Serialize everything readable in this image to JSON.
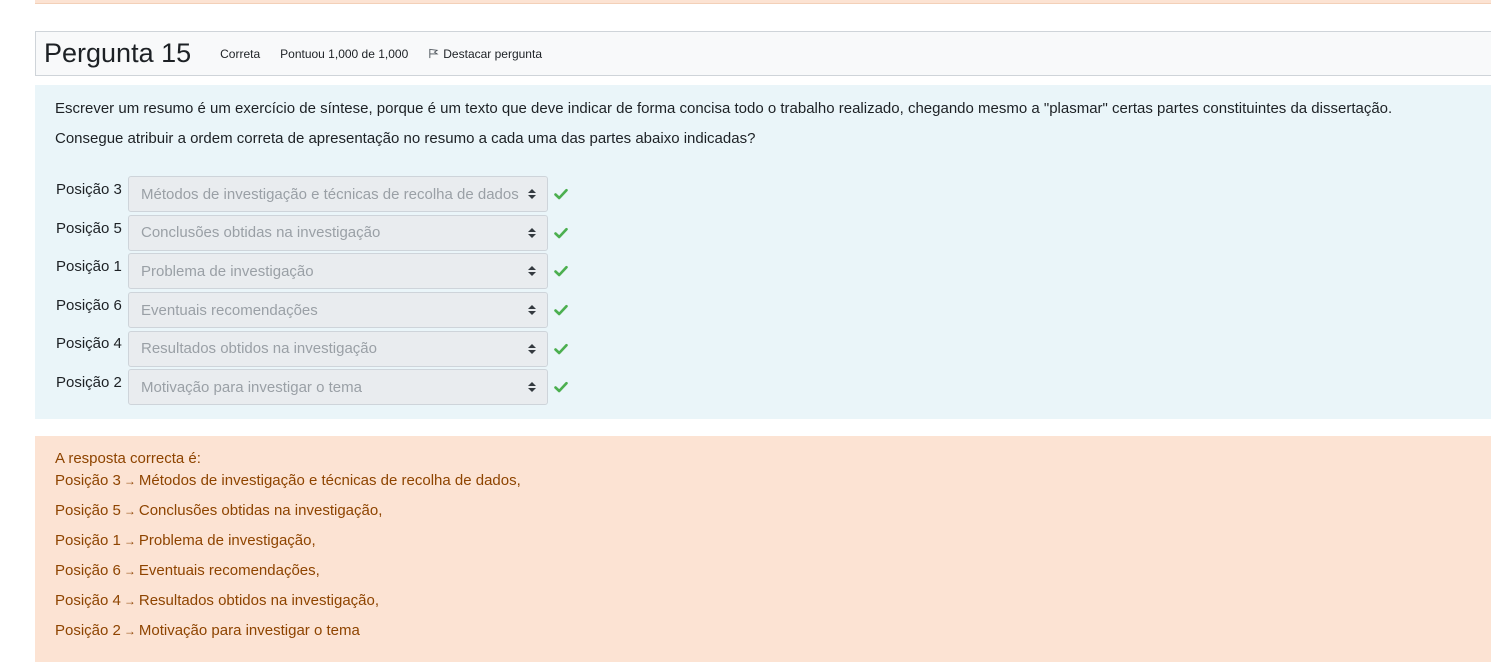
{
  "question": {
    "title": "Pergunta 15",
    "state": "Correta",
    "grade": "Pontuou 1,000 de 1,000",
    "flag_label": "Destacar pergunta",
    "text_1": "Escrever um resumo é um exercício de síntese, porque é um texto que deve indicar de forma concisa todo o trabalho realizado, chegando mesmo a \"plasmar\" certas partes constituintes da dissertação.",
    "text_2": "Consegue atribuir a ordem correta de apresentação no resumo a cada uma das partes abaixo indicadas?",
    "rows": [
      {
        "label": "Posição 3",
        "selected": "Métodos de investigação e técnicas de recolha de dados",
        "status": "correct"
      },
      {
        "label": "Posição 5",
        "selected": "Conclusões obtidas na investigação",
        "status": "correct"
      },
      {
        "label": "Posição 1",
        "selected": "Problema de investigação",
        "status": "correct"
      },
      {
        "label": "Posição 6",
        "selected": "Eventuais recomendações",
        "status": "correct"
      },
      {
        "label": "Posição 4",
        "selected": "Resultados obtidos na investigação",
        "status": "correct"
      },
      {
        "label": "Posição 2",
        "selected": "Motivação para investigar o tema",
        "status": "correct"
      }
    ]
  },
  "feedback": {
    "heading": "A resposta correcta é:",
    "arrow": "→",
    "lines": [
      {
        "pos": "Posição 3",
        "answer": "Métodos de investigação e técnicas de recolha de dados,"
      },
      {
        "pos": "Posição 5",
        "answer": "Conclusões obtidas na investigação,"
      },
      {
        "pos": "Posição 1",
        "answer": "Problema de investigação,"
      },
      {
        "pos": "Posição 6",
        "answer": "Eventuais recomendações,"
      },
      {
        "pos": "Posição 4",
        "answer": "Resultados obtidos na investigação,"
      },
      {
        "pos": "Posição 2",
        "answer": "Motivação para investigar o tema"
      }
    ]
  },
  "colors": {
    "correct_check": "#4caf50",
    "feedback_bg": "#fce3d3",
    "feedback_text": "#8e4400",
    "content_bg": "#eaf5f9"
  },
  "icons": {
    "flag": "flag-icon",
    "check": "check-icon",
    "select_arrows": "sort-arrows-icon"
  }
}
